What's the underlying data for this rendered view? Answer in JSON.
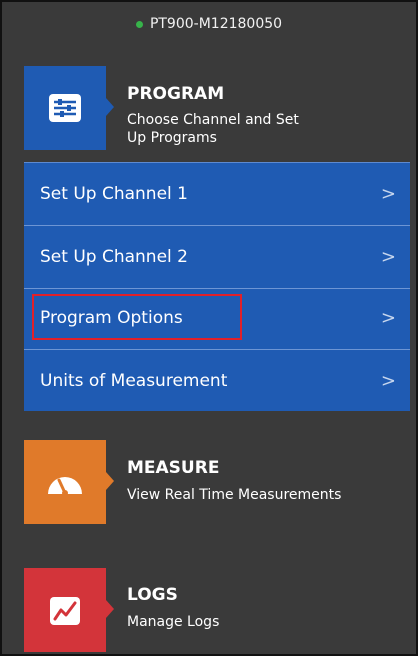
{
  "status": {
    "device_id": "PT900-M12180050",
    "indicator_color": "#37b34a"
  },
  "program": {
    "title": "PROGRAM",
    "subtitle_line1": "Choose Channel and Set",
    "subtitle_line2": "Up Programs",
    "icon": "sliders-icon",
    "color": "#1f5bb3"
  },
  "program_menu": {
    "items": [
      {
        "label": "Set Up Channel 1",
        "chevron": ">"
      },
      {
        "label": "Set Up Channel 2",
        "chevron": ">"
      },
      {
        "label": "Program Options",
        "chevron": ">"
      },
      {
        "label": "Units of Measurement",
        "chevron": ">"
      }
    ]
  },
  "measure": {
    "title": "MEASURE",
    "subtitle": "View Real Time Measurements",
    "icon": "gauge-icon",
    "color": "#e07a2a"
  },
  "logs": {
    "title": "LOGS",
    "subtitle": "Manage Logs",
    "icon": "trend-chart-icon",
    "color": "#d3343a"
  }
}
